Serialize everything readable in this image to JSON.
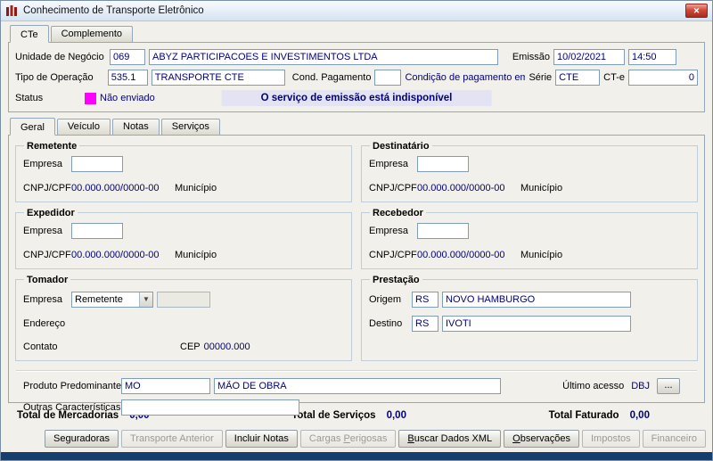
{
  "window": {
    "title": "Conhecimento de Transporte Eletrônico",
    "close_icon": "✕"
  },
  "main_tabs": [
    "CTe",
    "Complemento"
  ],
  "header": {
    "unidade_label": "Unidade de Negócio",
    "unidade_code": "069",
    "unidade_name": "ABYZ PARTICIPACOES E INVESTIMENTOS LTDA",
    "emissao_label": "Emissão",
    "emissao_date": "10/02/2021",
    "emissao_time": "14:50",
    "tipo_label": "Tipo de Operação",
    "tipo_code": "535.1",
    "tipo_name": "TRANSPORTE CTE",
    "cond_pag_label": "Cond. Pagamento",
    "cond_pag_value": "",
    "cond_pag_hint": "Condição de pagamento em branco",
    "serie_label": "Série",
    "serie_value": "CTE",
    "cte_label": "CT-e",
    "cte_value": "0",
    "status_label": "Status",
    "status_value": "Não enviado",
    "status_color": "#ff00ff",
    "service_message": "O serviço de emissão está indisponível"
  },
  "detail_tabs": [
    "Geral",
    "Veículo",
    "Notas",
    "Serviços"
  ],
  "remetente": {
    "title": "Remetente",
    "empresa_label": "Empresa",
    "empresa_code": "",
    "cnpj_label": "CNPJ/CPF",
    "cnpj_value": "00.000.000/0000-00",
    "municipio_label": "Município"
  },
  "destinatario": {
    "title": "Destinatário",
    "empresa_label": "Empresa",
    "empresa_code": "",
    "cnpj_label": "CNPJ/CPF",
    "cnpj_value": "00.000.000/0000-00",
    "municipio_label": "Município"
  },
  "expedidor": {
    "title": "Expedidor",
    "empresa_label": "Empresa",
    "empresa_code": "",
    "cnpj_label": "CNPJ/CPF",
    "cnpj_value": "00.000.000/0000-00",
    "municipio_label": "Município"
  },
  "recebedor": {
    "title": "Recebedor",
    "empresa_label": "Empresa",
    "empresa_code": "",
    "cnpj_label": "CNPJ/CPF",
    "cnpj_value": "00.000.000/0000-00",
    "municipio_label": "Município"
  },
  "tomador": {
    "title": "Tomador",
    "empresa_label": "Empresa",
    "empresa_tipo": "Remetente",
    "empresa_code": "",
    "endereco_label": "Endereço",
    "contato_label": "Contato",
    "cep_label": "CEP",
    "cep_value": "00000.000"
  },
  "prestacao": {
    "title": "Prestação",
    "origem_label": "Origem",
    "origem_uf": "RS",
    "origem_municipio": "NOVO HAMBURGO",
    "destino_label": "Destino",
    "destino_uf": "RS",
    "destino_municipio": "IVOTI"
  },
  "extra": {
    "produto_label": "Produto Predominante",
    "produto_code": "MO",
    "produto_desc": "MÃO DE OBRA",
    "ultimo_acesso_label": "Último acesso",
    "ultimo_acesso_value": "DBJ",
    "browse_button": "...",
    "outras_label": "Outras Características",
    "outras_value": ""
  },
  "totals": [
    {
      "label": "Total de Mercadorias",
      "value": "0,00"
    },
    {
      "label": "Total de Serviços",
      "value": "0,00"
    },
    {
      "label": "Total Faturado",
      "value": "0,00"
    }
  ],
  "buttons": [
    {
      "label": "Seguradoras",
      "enabled": true
    },
    {
      "label": "Transporte Anterior",
      "enabled": false
    },
    {
      "label": "Incluir Notas",
      "enabled": true
    },
    {
      "label": "Cargas Perigosas",
      "enabled": false
    },
    {
      "label": "Buscar Dados XML",
      "enabled": true
    },
    {
      "label": "Observações",
      "enabled": true
    },
    {
      "label": "Impostos",
      "enabled": false
    },
    {
      "label": "Financeiro",
      "enabled": false
    }
  ]
}
